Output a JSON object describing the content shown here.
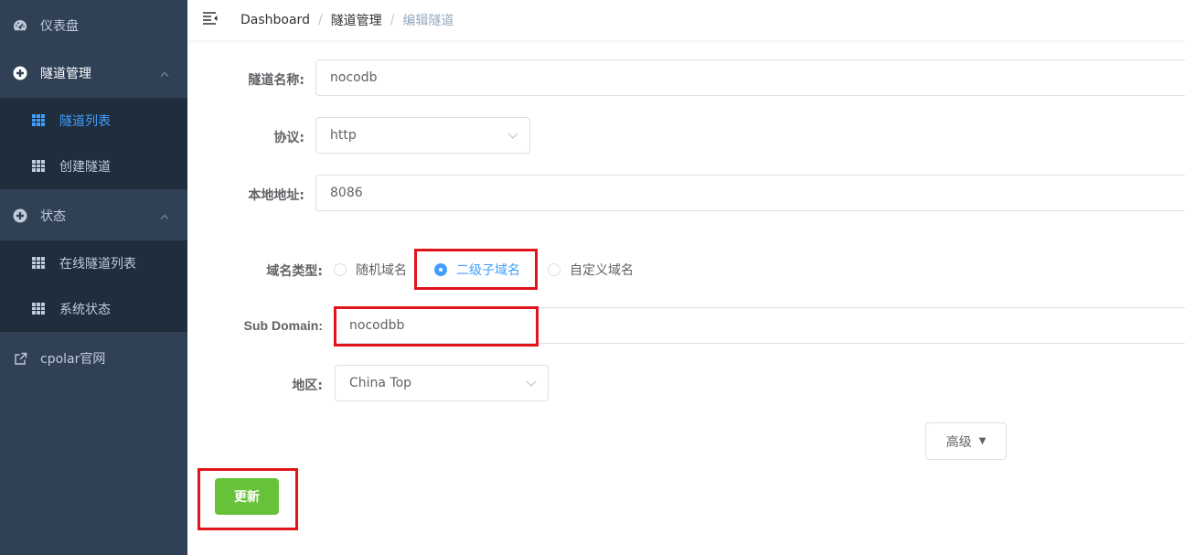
{
  "sidebar": {
    "items": [
      {
        "label": "仪表盘",
        "icon": "dashboard-icon"
      },
      {
        "label": "隧道管理",
        "icon": "tunnel-icon",
        "expanded": true,
        "children": [
          {
            "label": "隧道列表",
            "icon": "grid-icon",
            "active": true
          },
          {
            "label": "创建隧道",
            "icon": "grid-icon"
          }
        ]
      },
      {
        "label": "状态",
        "icon": "status-icon",
        "expanded": true,
        "children": [
          {
            "label": "在线隧道列表",
            "icon": "grid-icon"
          },
          {
            "label": "系统状态",
            "icon": "grid-icon"
          }
        ]
      },
      {
        "label": "cpolar官网",
        "icon": "external-link-icon"
      }
    ]
  },
  "header": {
    "breadcrumb": [
      "Dashboard",
      "隧道管理",
      "编辑隧道"
    ],
    "separator": "/"
  },
  "form": {
    "tunnel_name": {
      "label": "隧道名称:",
      "value": "nocodb"
    },
    "protocol": {
      "label": "协议:",
      "value": "http"
    },
    "local_address": {
      "label": "本地地址:",
      "value": "8086"
    },
    "domain_type": {
      "label": "域名类型:",
      "options": [
        "随机域名",
        "二级子域名",
        "自定义域名"
      ],
      "selected": "二级子域名"
    },
    "sub_domain": {
      "label": "Sub Domain:",
      "value": "nocodbb"
    },
    "region": {
      "label": "地区:",
      "value": "China Top"
    },
    "advanced_label": "高级",
    "update_label": "更新"
  },
  "colors": {
    "sidebar_bg": "#304156",
    "submenu_bg": "#1f2d3d",
    "active": "#409eff",
    "update_button": "#67c23a",
    "highlight": "#e0141a"
  }
}
